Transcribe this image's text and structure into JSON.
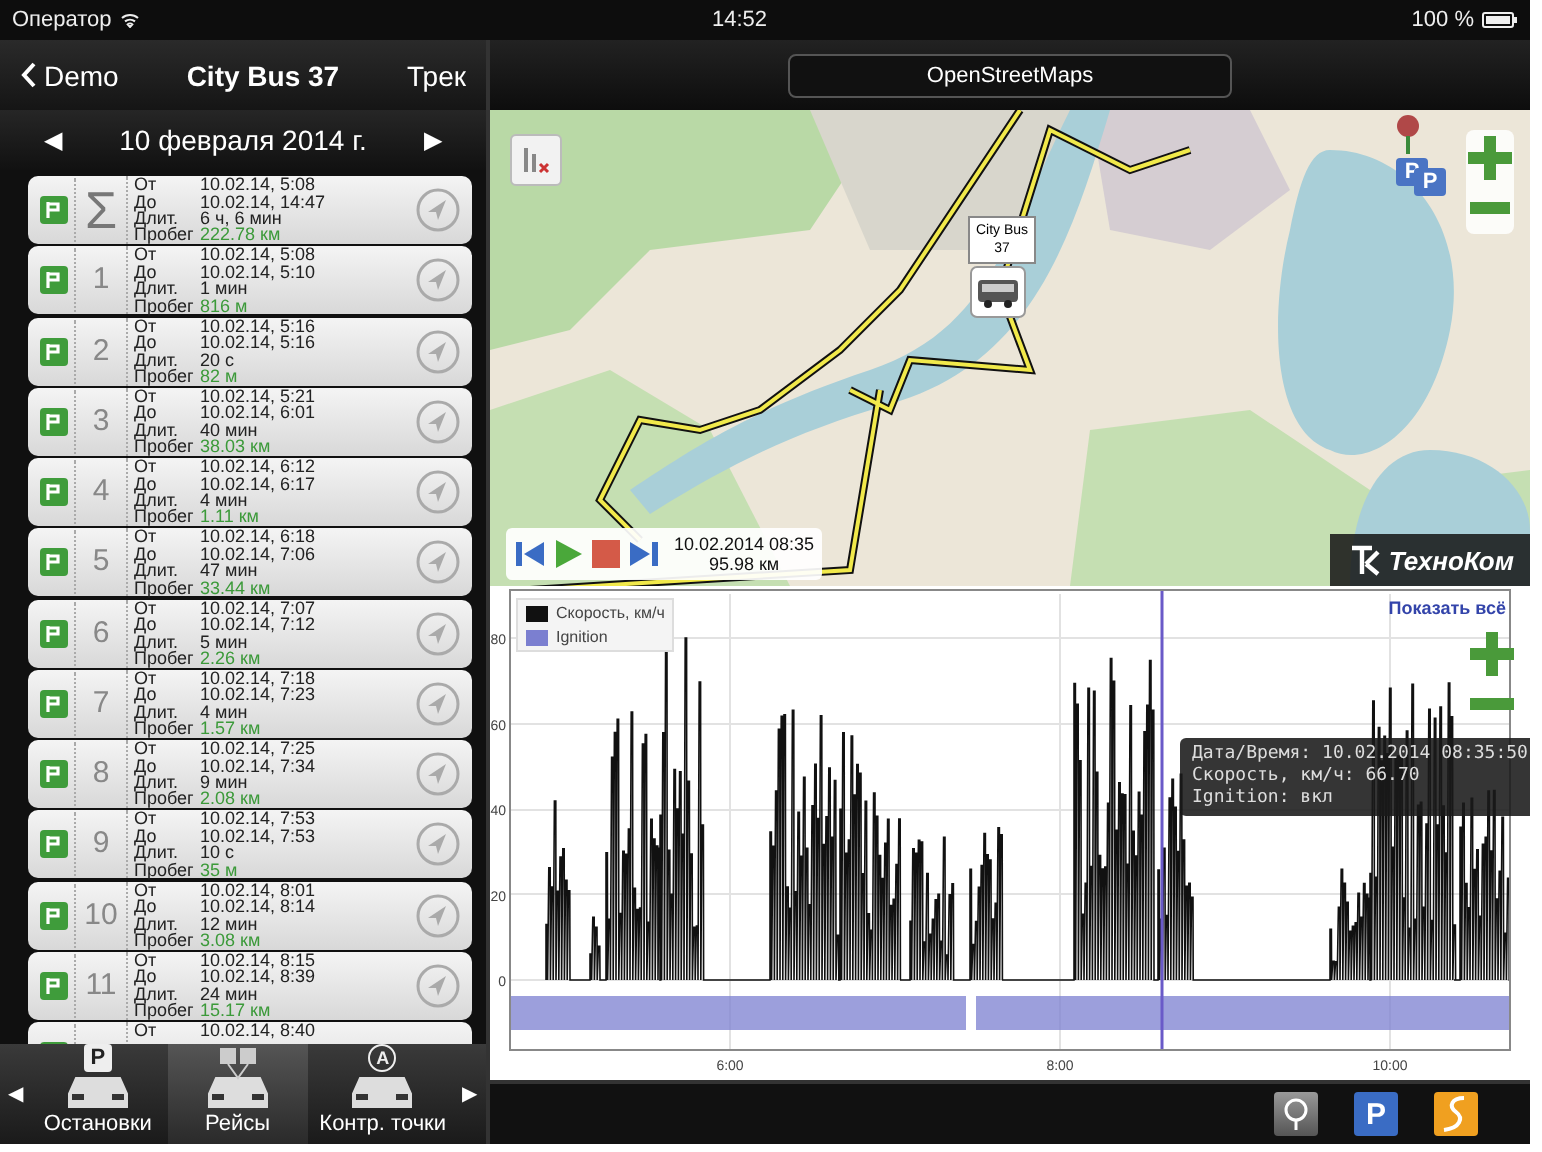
{
  "status_bar": {
    "carrier": "Оператор",
    "time": "14:52",
    "battery": "100 %"
  },
  "nav_bar": {
    "back": "Demo",
    "title": "City Bus 37",
    "action": "Трек"
  },
  "date_bar": {
    "prev": "◀",
    "date": "10 февраля 2014 г.",
    "next": "▶"
  },
  "trips": [
    {
      "number": "Σ",
      "kind": "total",
      "lines": [
        {
          "label": "От",
          "value": "10.02.14, 5:08",
          "kind": "plain"
        },
        {
          "label": "До",
          "value": "10.02.14, 14:47",
          "kind": "plain"
        },
        {
          "label": "Длит.",
          "value": "6 ч, 6 мин",
          "kind": "plain"
        },
        {
          "label": "Пробег",
          "value": "222.78 км",
          "kind": "distance"
        }
      ]
    },
    {
      "number": "1",
      "kind": "trip",
      "lines": [
        {
          "label": "От",
          "value": "10.02.14, 5:08",
          "kind": "plain"
        },
        {
          "label": "До",
          "value": "10.02.14, 5:10",
          "kind": "plain"
        },
        {
          "label": "Длит.",
          "value": "1 мин",
          "kind": "plain"
        },
        {
          "label": "Пробег",
          "value": "816 м",
          "kind": "distance"
        }
      ]
    },
    {
      "number": "2",
      "kind": "trip",
      "lines": [
        {
          "label": "От",
          "value": "10.02.14, 5:16",
          "kind": "plain"
        },
        {
          "label": "До",
          "value": "10.02.14, 5:16",
          "kind": "plain"
        },
        {
          "label": "Длит.",
          "value": "20 с",
          "kind": "plain"
        },
        {
          "label": "Пробег",
          "value": "82 м",
          "kind": "distance"
        }
      ]
    },
    {
      "number": "3",
      "kind": "trip",
      "lines": [
        {
          "label": "От",
          "value": "10.02.14, 5:21",
          "kind": "plain"
        },
        {
          "label": "До",
          "value": "10.02.14, 6:01",
          "kind": "plain"
        },
        {
          "label": "Длит.",
          "value": "40 мин",
          "kind": "plain"
        },
        {
          "label": "Пробег",
          "value": "38.03 км",
          "kind": "distance"
        }
      ]
    },
    {
      "number": "4",
      "kind": "trip",
      "lines": [
        {
          "label": "От",
          "value": "10.02.14, 6:12",
          "kind": "plain"
        },
        {
          "label": "До",
          "value": "10.02.14, 6:17",
          "kind": "plain"
        },
        {
          "label": "Длит.",
          "value": "4 мин",
          "kind": "plain"
        },
        {
          "label": "Пробег",
          "value": "1.11 км",
          "kind": "distance"
        }
      ]
    },
    {
      "number": "5",
      "kind": "trip",
      "lines": [
        {
          "label": "От",
          "value": "10.02.14, 6:18",
          "kind": "plain"
        },
        {
          "label": "До",
          "value": "10.02.14, 7:06",
          "kind": "plain"
        },
        {
          "label": "Длит.",
          "value": "47 мин",
          "kind": "plain"
        },
        {
          "label": "Пробег",
          "value": "33.44 км",
          "kind": "distance"
        }
      ]
    },
    {
      "number": "6",
      "kind": "trip",
      "lines": [
        {
          "label": "От",
          "value": "10.02.14, 7:07",
          "kind": "plain"
        },
        {
          "label": "До",
          "value": "10.02.14, 7:12",
          "kind": "plain"
        },
        {
          "label": "Длит.",
          "value": "5 мин",
          "kind": "plain"
        },
        {
          "label": "Пробег",
          "value": "2.26 км",
          "kind": "distance"
        }
      ]
    },
    {
      "number": "7",
      "kind": "trip",
      "lines": [
        {
          "label": "От",
          "value": "10.02.14, 7:18",
          "kind": "plain"
        },
        {
          "label": "До",
          "value": "10.02.14, 7:23",
          "kind": "plain"
        },
        {
          "label": "Длит.",
          "value": "4 мин",
          "kind": "plain"
        },
        {
          "label": "Пробег",
          "value": "1.57 км",
          "kind": "distance"
        }
      ]
    },
    {
      "number": "8",
      "kind": "trip",
      "lines": [
        {
          "label": "От",
          "value": "10.02.14, 7:25",
          "kind": "plain"
        },
        {
          "label": "До",
          "value": "10.02.14, 7:34",
          "kind": "plain"
        },
        {
          "label": "Длит.",
          "value": "9 мин",
          "kind": "plain"
        },
        {
          "label": "Пробег",
          "value": "2.08 км",
          "kind": "distance"
        }
      ]
    },
    {
      "number": "9",
      "kind": "trip",
      "lines": [
        {
          "label": "От",
          "value": "10.02.14, 7:53",
          "kind": "plain"
        },
        {
          "label": "До",
          "value": "10.02.14, 7:53",
          "kind": "plain"
        },
        {
          "label": "Длит.",
          "value": "10 с",
          "kind": "plain"
        },
        {
          "label": "Пробег",
          "value": "35 м",
          "kind": "distance"
        }
      ]
    },
    {
      "number": "10",
      "kind": "trip",
      "lines": [
        {
          "label": "От",
          "value": "10.02.14, 8:01",
          "kind": "plain"
        },
        {
          "label": "До",
          "value": "10.02.14, 8:14",
          "kind": "plain"
        },
        {
          "label": "Длит.",
          "value": "12 мин",
          "kind": "plain"
        },
        {
          "label": "Пробег",
          "value": "3.08 км",
          "kind": "distance"
        }
      ]
    },
    {
      "number": "11",
      "kind": "trip",
      "lines": [
        {
          "label": "От",
          "value": "10.02.14, 8:15",
          "kind": "plain"
        },
        {
          "label": "До",
          "value": "10.02.14, 8:39",
          "kind": "plain"
        },
        {
          "label": "Длит.",
          "value": "24 мин",
          "kind": "plain"
        },
        {
          "label": "Пробег",
          "value": "15.17 км",
          "kind": "distance"
        }
      ]
    },
    {
      "kind": "trip",
      "lines": [
        {
          "label": "От",
          "value": "10.02.14, 8:40",
          "kind": "plain"
        }
      ]
    }
  ],
  "tab_bar": {
    "prev": "◀",
    "next": "▶",
    "tabs": [
      {
        "label": "Остановки",
        "glyph": "P",
        "selected": false
      },
      {
        "label": "Рейсы",
        "selected": true
      },
      {
        "label": "Контр. точки",
        "glyph": "A",
        "selected": false
      }
    ]
  },
  "map": {
    "source": "OpenStreetMaps",
    "vehicle_label": "City Bus 37",
    "markers": [
      {
        "glyph": "P"
      },
      {
        "glyph": "P"
      }
    ],
    "player": {
      "datetime": "10.02.2014 08:35",
      "distance": "95.98 км"
    },
    "logo": "ТехноКом"
  },
  "speed_chart": {
    "show_all": "Показать всё",
    "legend": [
      {
        "label": "Скорость, км/ч",
        "color": "#111111"
      },
      {
        "label": "Ignition",
        "color": "#7b7fd0"
      }
    ],
    "y_tick_labels": [
      "80",
      "60",
      "40",
      "20",
      "0"
    ],
    "x_tick_labels": [
      "6:00",
      "8:00",
      "10:00"
    ],
    "tooltip": [
      "Дата/Время: 10.02.2014 08:35:50",
      "Скорость, км/ч: 66.70",
      "Ignition: вкл"
    ]
  },
  "toolbar": [
    {
      "kind": "pin"
    },
    {
      "kind": "parking",
      "glyph": "P"
    },
    {
      "kind": "route"
    }
  ]
}
